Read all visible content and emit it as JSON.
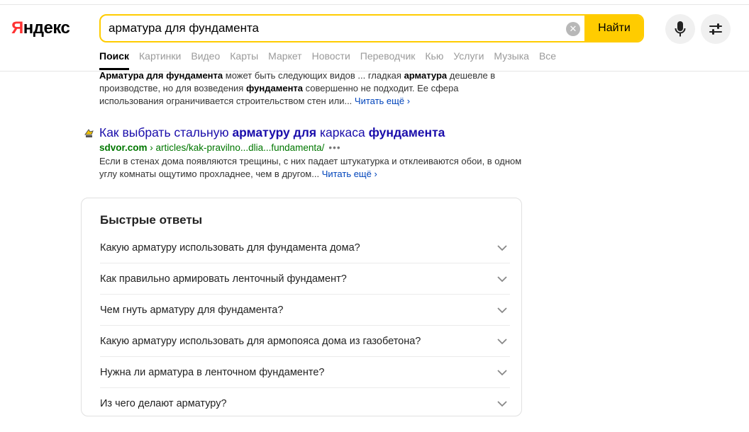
{
  "header": {
    "logo_first": "Я",
    "logo_rest": "ндекс",
    "search_value": "арматура для фундамента",
    "search_button": "Найти",
    "clear_symbol": "✕"
  },
  "tabs": [
    {
      "label": "Поиск",
      "active": true
    },
    {
      "label": "Картинки"
    },
    {
      "label": "Видео"
    },
    {
      "label": "Карты"
    },
    {
      "label": "Маркет"
    },
    {
      "label": "Новости"
    },
    {
      "label": "Переводчик"
    },
    {
      "label": "Кью"
    },
    {
      "label": "Услуги"
    },
    {
      "label": "Музыка"
    },
    {
      "label": "Все"
    }
  ],
  "prev_result": {
    "line1_b1": "Арматура для фундамента",
    "line1_t1": " может быть следующих видов ... гладкая ",
    "line1_b2": "арматура",
    "line1_t2": " дешевле в",
    "line2_t1": "производстве, но для возведения ",
    "line2_b1": "фундамента",
    "line2_t2": " совершенно не подходит. Ее сфера",
    "line3_t1": "использования ограничивается строительством стен или... ",
    "more": "Читать ещё ›"
  },
  "result": {
    "title_t1": "Как выбрать стальную ",
    "title_b1": "арматуру для",
    "title_t2": " каркаса ",
    "title_b2": "фундамента",
    "domain": "sdvor.com",
    "sep": " › ",
    "path": "articles/kak-pravilno...dlia...fundamenta/",
    "dots": "•••",
    "snippet_line1": "Если в стенах дома появляются трещины, с них падает штукатурка и отклеиваются обои, в одном",
    "snippet_line2": "углу комнаты ощутимо прохладнее, чем в другом... ",
    "more": "Читать ещё ›"
  },
  "quick_answers": {
    "title": "Быстрые ответы",
    "items": [
      "Какую арматуру использовать для фундамента дома?",
      "Как правильно армировать ленточный фундамент?",
      "Чем гнуть арматуру для фундамента?",
      "Какую арматуру использовать для армопояса дома из газобетона?",
      "Нужна ли арматура в ленточном фундаменте?",
      "Из чего делают арматуру?"
    ]
  },
  "colors": {
    "accent": "#ffcc00",
    "link": "#1a0dab",
    "url": "#007700",
    "logo_red": "#ff3333"
  }
}
